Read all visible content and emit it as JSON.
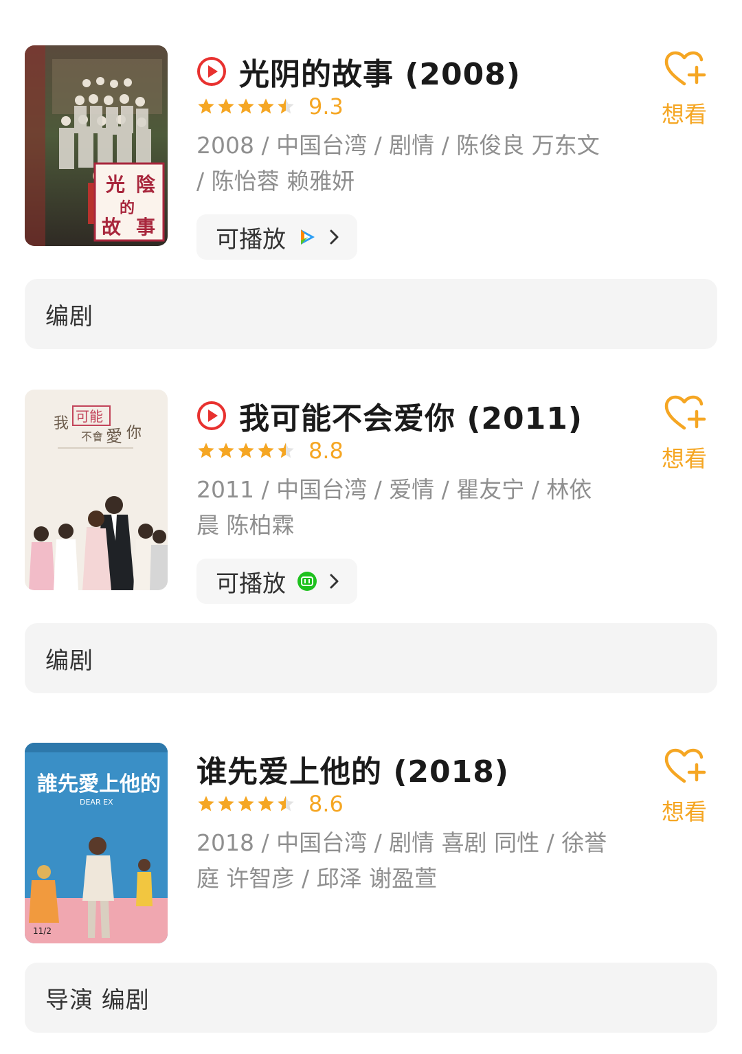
{
  "movies": [
    {
      "title": "光阴的故事 (2008)",
      "has_play_icon": true,
      "stars": 4.5,
      "score": "9.3",
      "meta": "2008 / 中国台湾 / 剧情 / 陈俊良 万东文 / 陈怡蓉 赖雅妍",
      "play_label": "可播放",
      "source_icon": "tencent-video-icon",
      "want_label": "想看",
      "role": "编剧",
      "poster_text": [
        "光",
        "陰",
        "的",
        "故",
        "事"
      ]
    },
    {
      "title": "我可能不会爱你 (2011)",
      "has_play_icon": true,
      "stars": 4.5,
      "score": "8.8",
      "meta": "2011 / 中国台湾 / 爱情 / 瞿友宁 / 林依晨 陈柏霖",
      "play_label": "可播放",
      "source_icon": "iqiyi-icon",
      "want_label": "想看",
      "role": "编剧",
      "poster_text": [
        "我",
        "可能",
        "不會",
        "愛",
        "你"
      ]
    },
    {
      "title": "谁先爱上他的 (2018)",
      "has_play_icon": false,
      "stars": 4.5,
      "score": "8.6",
      "meta": "2018 / 中国台湾 / 剧情 喜剧 同性 / 徐誉庭 许智彦 / 邱泽 谢盈萱",
      "want_label": "想看",
      "role": "导演 编剧",
      "poster_text": [
        "誰先愛上他的",
        "DEAR EX",
        "11/2"
      ]
    }
  ],
  "colors": {
    "accent_orange": "#f5a623",
    "play_red": "#e8312f",
    "meta_gray": "#8f8f8f",
    "iqiyi_green": "#1ec11e"
  }
}
